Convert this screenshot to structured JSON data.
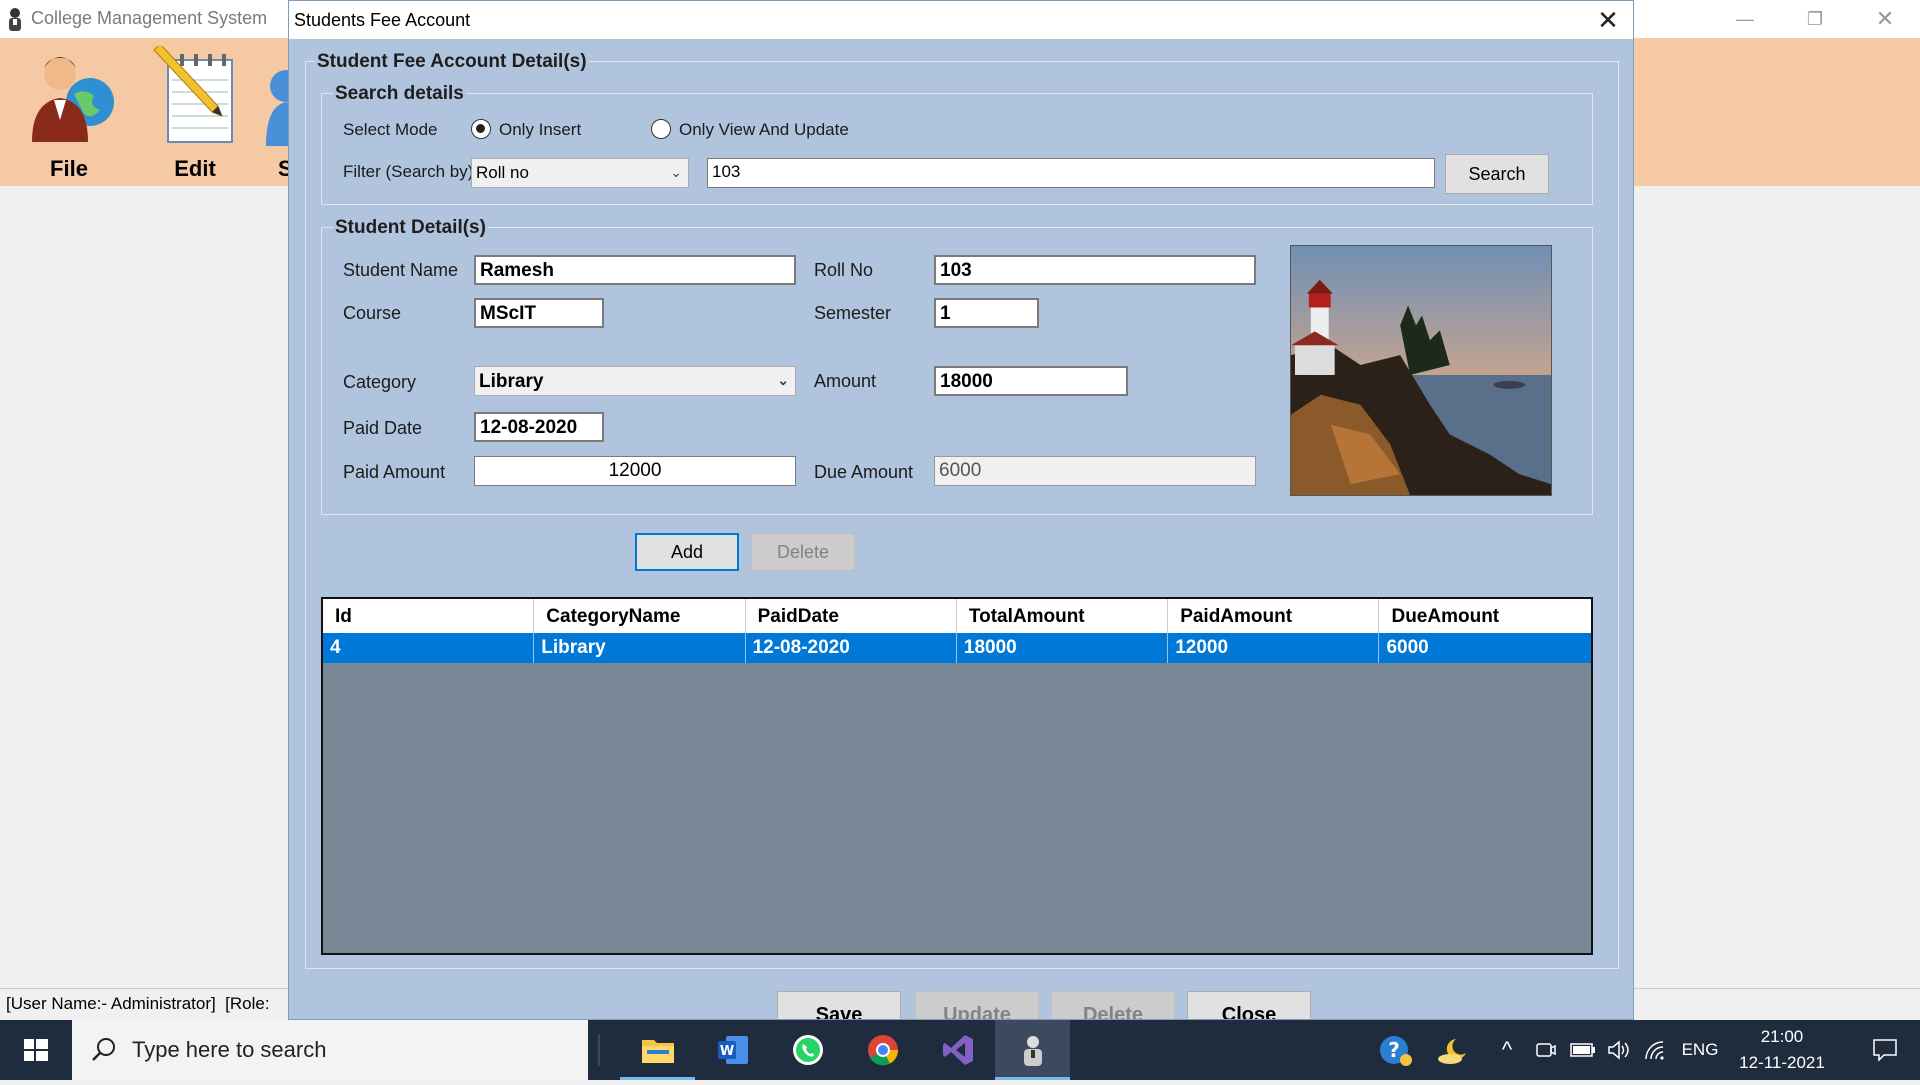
{
  "main_window": {
    "title": "College Management System",
    "toolbar": {
      "file_label": "File",
      "edit_label": "Edit",
      "third_label": "S"
    },
    "status_text": "[User Name:- Administrator]  [Role:"
  },
  "dialog": {
    "title": "Students Fee Account",
    "outer_group": "Student Fee Account Detail(s)",
    "search": {
      "caption": "Search details",
      "select_mode_label": "Select Mode",
      "mode_insert": "Only Insert",
      "mode_view_update": "Only View And Update",
      "selected_mode": "Only Insert",
      "filter_label": "Filter (Search by)",
      "filter_value": "Roll no",
      "search_value": "103",
      "search_button": "Search"
    },
    "student": {
      "caption": "Student Detail(s)",
      "name_label": "Student Name",
      "name_value": "Ramesh",
      "rollno_label": "Roll No",
      "rollno_value": "103",
      "course_label": "Course",
      "course_value": "MScIT",
      "semester_label": "Semester",
      "semester_value": "1",
      "category_label": "Category",
      "category_value": "Library",
      "amount_label": "Amount",
      "amount_value": "18000",
      "paid_date_label": "Paid Date",
      "paid_date_value": "12-08-2020",
      "paid_amount_label": "Paid Amount",
      "paid_amount_value": "12000",
      "due_amount_label": "Due Amount",
      "due_amount_value": "6000"
    },
    "add_button": "Add",
    "delete_row_button": "Delete",
    "grid": {
      "columns": [
        "Id",
        "CategoryName",
        "PaidDate",
        "TotalAmount",
        "PaidAmount",
        "DueAmount"
      ],
      "rows": [
        [
          "4",
          "Library",
          "12-08-2020",
          "18000",
          "12000",
          "6000"
        ]
      ]
    },
    "bottom_buttons": {
      "save": "Save",
      "update": "Update",
      "delete": "Delete",
      "close": "Close"
    }
  },
  "taskbar": {
    "search_placeholder": "Type here to search",
    "language": "ENG",
    "time": "21:00",
    "date": "12-11-2021"
  },
  "colors": {
    "dialog_bg": "#b0c4de",
    "toolbar_bg": "#f5c9a4",
    "selection": "#0078d7",
    "grid_bg": "#798897",
    "taskbar_bg": "#1f2c3d"
  }
}
